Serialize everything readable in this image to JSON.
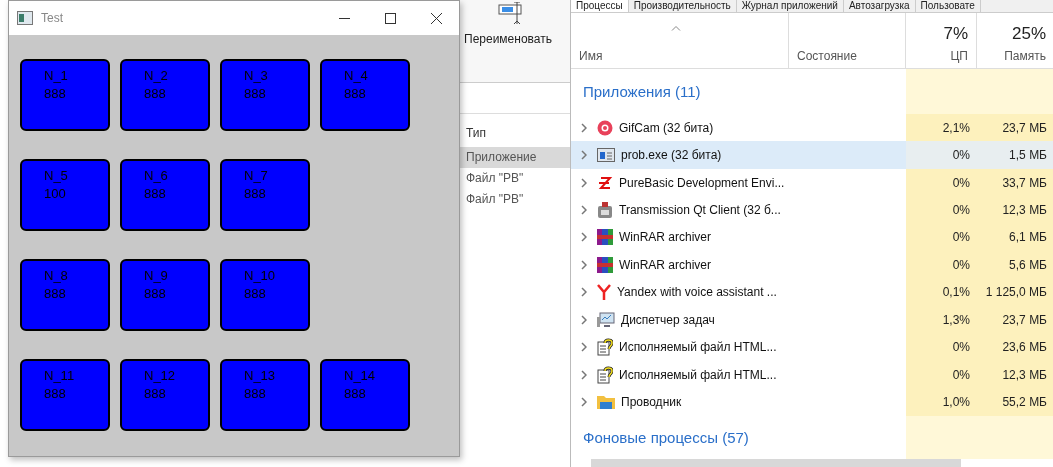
{
  "explorer": {
    "ribbon_button": "Переименовать",
    "column": "Тип",
    "rows": [
      {
        "type": "Приложение",
        "selected": true
      },
      {
        "type": "Файл \"PB\"",
        "selected": false
      },
      {
        "type": "Файл \"PB\"",
        "selected": false
      }
    ]
  },
  "test_window": {
    "title": "Test",
    "grid_rows": [
      [
        {
          "name": "N_1",
          "value": "888"
        },
        {
          "name": "N_2",
          "value": "888"
        },
        {
          "name": "N_3",
          "value": "888"
        },
        {
          "name": "N_4",
          "value": "888"
        }
      ],
      [
        {
          "name": "N_5",
          "value": "100"
        },
        {
          "name": "N_6",
          "value": "888"
        },
        {
          "name": "N_7",
          "value": "888"
        }
      ],
      [
        {
          "name": "N_8",
          "value": "888"
        },
        {
          "name": "N_9",
          "value": "888"
        },
        {
          "name": "N_10",
          "value": "888"
        }
      ],
      [
        {
          "name": "N_11",
          "value": "888"
        },
        {
          "name": "N_12",
          "value": "888"
        },
        {
          "name": "N_13",
          "value": "888"
        },
        {
          "name": "N_14",
          "value": "888"
        }
      ]
    ]
  },
  "task_manager": {
    "tabs": [
      {
        "label": "Процессы",
        "selected": true
      },
      {
        "label": "Производительность",
        "selected": false
      },
      {
        "label": "Журнал приложений",
        "selected": false
      },
      {
        "label": "Автозагрузка",
        "selected": false
      },
      {
        "label": "Пользовате",
        "selected": false
      }
    ],
    "columns": {
      "name": "Имя",
      "status": "Состояние",
      "cpu_total": "7%",
      "cpu": "ЦП",
      "memory_total": "25%",
      "memory": "Память"
    },
    "apps_group": "Приложения (11)",
    "processes": [
      {
        "name": "GifCam (32 бита)",
        "cpu": "2,1%",
        "memory": "23,7 МБ",
        "selected": false
      },
      {
        "name": "prob.exe (32 бита)",
        "cpu": "0%",
        "memory": "1,5 МБ",
        "selected": true
      },
      {
        "name": "PureBasic Development Envi...",
        "cpu": "0%",
        "memory": "33,7 МБ",
        "selected": false
      },
      {
        "name": "Transmission Qt Client (32 б...",
        "cpu": "0%",
        "memory": "12,3 МБ",
        "selected": false
      },
      {
        "name": "WinRAR archiver",
        "cpu": "0%",
        "memory": "6,1 МБ",
        "selected": false
      },
      {
        "name": "WinRAR archiver",
        "cpu": "0%",
        "memory": "5,6 МБ",
        "selected": false
      },
      {
        "name": "Yandex with voice assistant ...",
        "cpu": "0,1%",
        "memory": "1 125,0 МБ",
        "selected": false
      },
      {
        "name": "Диспетчер задач",
        "cpu": "1,3%",
        "memory": "23,7 МБ",
        "selected": false
      },
      {
        "name": "Исполняемый файл HTML...",
        "cpu": "0%",
        "memory": "23,6 МБ",
        "selected": false
      },
      {
        "name": "Исполняемый файл HTML...",
        "cpu": "0%",
        "memory": "12,3 МБ",
        "selected": false
      },
      {
        "name": "Проводник",
        "cpu": "1,0%",
        "memory": "55,2 МБ",
        "selected": false
      }
    ],
    "background_group": "Фоновые процессы (57)"
  }
}
